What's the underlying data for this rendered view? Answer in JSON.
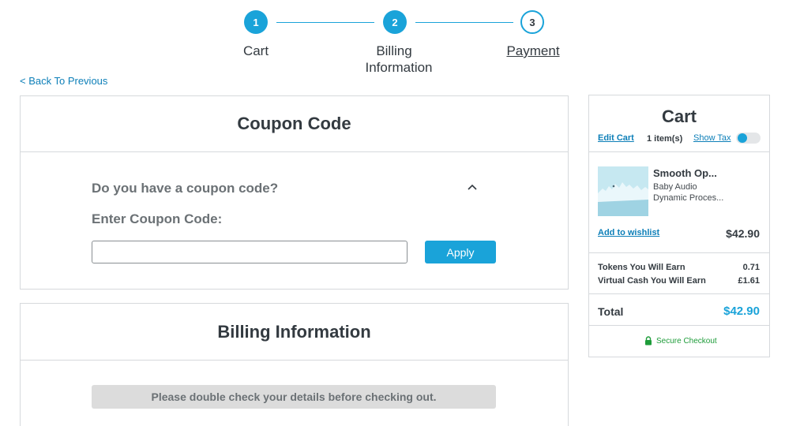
{
  "stepper": {
    "steps": [
      {
        "number": "1",
        "label": "Cart"
      },
      {
        "number": "2",
        "label_line1": "Billing",
        "label_line2": "Information"
      },
      {
        "number": "3",
        "label": "Payment"
      }
    ],
    "accent_color": "#1aa3d9"
  },
  "nav": {
    "back_label": "< Back To Previous"
  },
  "coupon": {
    "title": "Coupon Code",
    "question": "Do you have a coupon code?",
    "field_label": "Enter Coupon Code:",
    "input_value": "",
    "input_placeholder": "",
    "apply_label": "Apply"
  },
  "billing": {
    "title": "Billing Information",
    "notice": "Please double check your details before checking out."
  },
  "cart": {
    "title": "Cart",
    "edit_label": "Edit Cart",
    "item_count": "1 item(s)",
    "show_tax_label": "Show Tax",
    "show_tax_on": false,
    "item": {
      "name": "Smooth Op...",
      "brand": "Baby Audio",
      "category": "Dynamic Proces...",
      "wishlist_label": "Add to wishlist",
      "price": "$42.90"
    },
    "tokens_label": "Tokens You Will Earn",
    "tokens_value": "0.71",
    "virtual_cash_label": "Virtual Cash You Will Earn",
    "virtual_cash_value": "£1.61",
    "total_label": "Total",
    "total_value": "$42.90",
    "secure_label": "Secure Checkout"
  }
}
